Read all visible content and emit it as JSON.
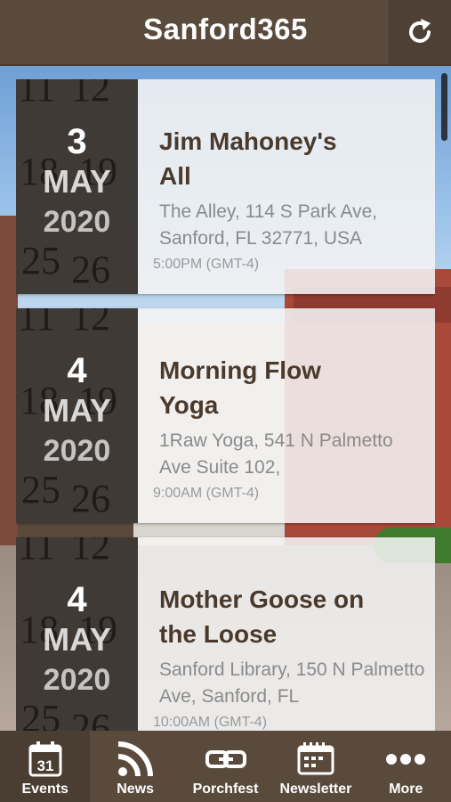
{
  "app": {
    "title": "Sanford365"
  },
  "header": {
    "refresh_icon": "refresh-icon"
  },
  "events": [
    {
      "day": "3",
      "month": "MAY",
      "year": "2020",
      "title": "Jim Mahoney's All",
      "address": "The Alley, 114 S Park Ave, Sanford, FL 32771, USA",
      "time": "5:00PM (GMT-4)"
    },
    {
      "day": "4",
      "month": "MAY",
      "year": "2020",
      "title": "Morning Flow Yoga",
      "address": "1Raw Yoga, 541 N Palmetto Ave Suite 102,",
      "time": "9:00AM (GMT-4)"
    },
    {
      "day": "4",
      "month": "MAY",
      "year": "2020",
      "title": "Mother Goose on the Loose",
      "address": "Sanford Library, 150 N Palmetto Ave, Sanford, FL",
      "time": "10:00AM (GMT-4)"
    }
  ],
  "tabs": [
    {
      "label": "Events",
      "icon": "calendar-icon",
      "badge": "31",
      "active": true
    },
    {
      "label": "News",
      "icon": "rss-icon",
      "active": false
    },
    {
      "label": "Porchfest",
      "icon": "link-icon",
      "active": false
    },
    {
      "label": "Newsletter",
      "icon": "newsletter-icon",
      "active": false
    },
    {
      "label": "More",
      "icon": "more-dots-icon",
      "active": false
    }
  ],
  "colors": {
    "header_bg": "#5a4a3c",
    "title_text": "#4b3a2b",
    "date_tile_bg": "#403a36"
  }
}
